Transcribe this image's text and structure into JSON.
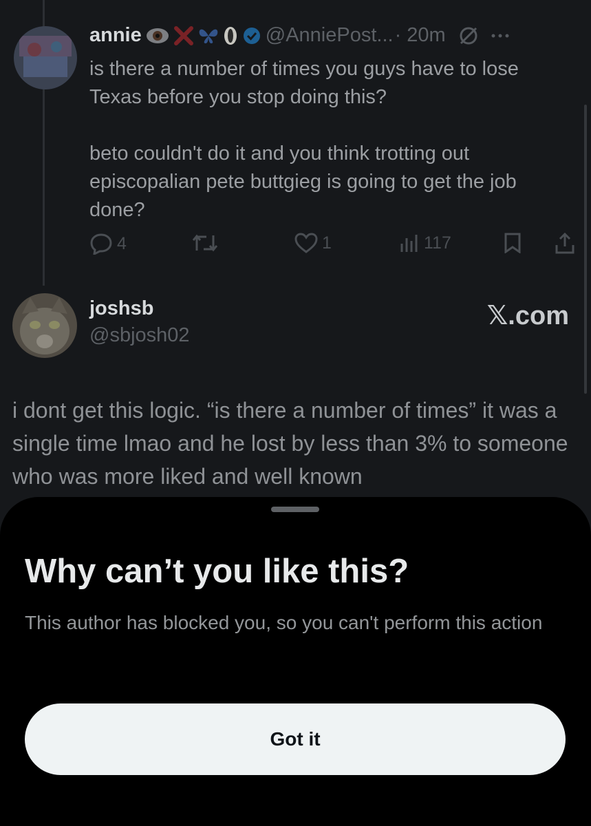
{
  "tweet": {
    "author_name": "annie",
    "emojis": [
      "eye-emoji",
      "cross-mark-emoji",
      "butterfly-emoji",
      "oval-emoji"
    ],
    "handle": "@AnniePost...",
    "time": "· 20m",
    "body_paragraphs": [
      "is there a number of times you guys have to lose Texas before you stop doing this?",
      "beto couldn't do it and you think trotting out episcopalian pete buttgieg is going to get the job done?"
    ],
    "replies_count": "4",
    "likes_count": "1",
    "views_count": "117"
  },
  "reply": {
    "author_name": "joshsb",
    "handle": "@sbjosh02",
    "watermark": "𝕏.com",
    "body": "i dont get this logic. “is there a number of times” it was a single time lmao and he lost by less than 3% to someone who was more liked and well known"
  },
  "sheet": {
    "title": "Why can’t you like this?",
    "message": "This author has blocked you, so you can't perform this action",
    "button_label": "Got it"
  },
  "colors": {
    "sheet_background": "#000000",
    "button_background": "#eff3f4",
    "verified_blue": "#1d9bf0"
  }
}
